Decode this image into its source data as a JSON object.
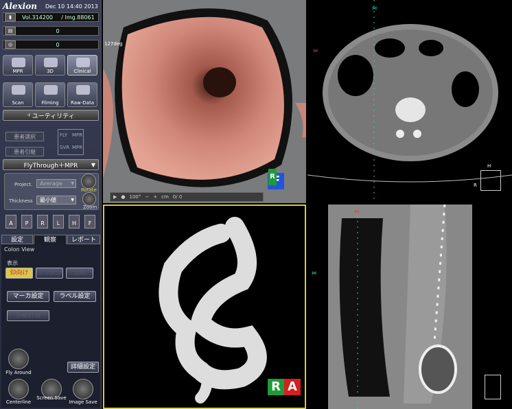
{
  "header": {
    "logo": "Alexion",
    "datetime": "Dec 10 14:40 2013"
  },
  "info": {
    "vol": "Vol.314200",
    "img": "/ Img.88061",
    "row2": "0",
    "row3": "0"
  },
  "modes": [
    {
      "label": "MPR"
    },
    {
      "label": "3D"
    },
    {
      "label": "Clinical"
    }
  ],
  "tools": [
    {
      "label": "Scan"
    },
    {
      "label": "Filming"
    },
    {
      "label": "Raw-Data"
    }
  ],
  "utility": "ユーティリティ",
  "patient": {
    "select": "患者選択",
    "transfer": "患者引継"
  },
  "flymodes": {
    "fly": "FLY",
    "mpr": "MPR",
    "svr": "SVR"
  },
  "mode_select": "FlyThrough＋MPR",
  "project": {
    "label": "Project.",
    "value": "Average",
    "rotate": "Rotate"
  },
  "thickness": {
    "label": "Thickness",
    "value": "最小値",
    "zoom": "Zoom"
  },
  "orient_keys": [
    "A",
    "P",
    "R",
    "L",
    "H",
    "F"
  ],
  "tabs": [
    "設定",
    "観察",
    "レポート"
  ],
  "colon_view": "Colon View",
  "display": "表示",
  "display_buttons": [
    "仰向け",
    "うつ伏せ",
    "比較"
  ],
  "marker_btn": "マーカ設定",
  "label_btn": "ラベル設定",
  "auto_btn": "自動計測",
  "fly": "Fly Around",
  "detail_btn": "詳細設定",
  "bottom": [
    {
      "label": "Centerline"
    },
    {
      "label": "Screen Save"
    },
    {
      "label": "Image Save"
    }
  ],
  "endo": {
    "angle": "127deg",
    "ctrl_val": "100°",
    "ctrl_unit": "cm",
    "ctrl_count": "0/ 0"
  },
  "cubes": {
    "endo": [
      "R",
      "F"
    ],
    "vr": [
      "R",
      "A"
    ]
  },
  "axial": {
    "h": "H",
    "r": "R"
  },
  "colors": {
    "accent": "#d9c84a",
    "marker": "#1fd4b8",
    "marker_red": "#e03a3a"
  }
}
